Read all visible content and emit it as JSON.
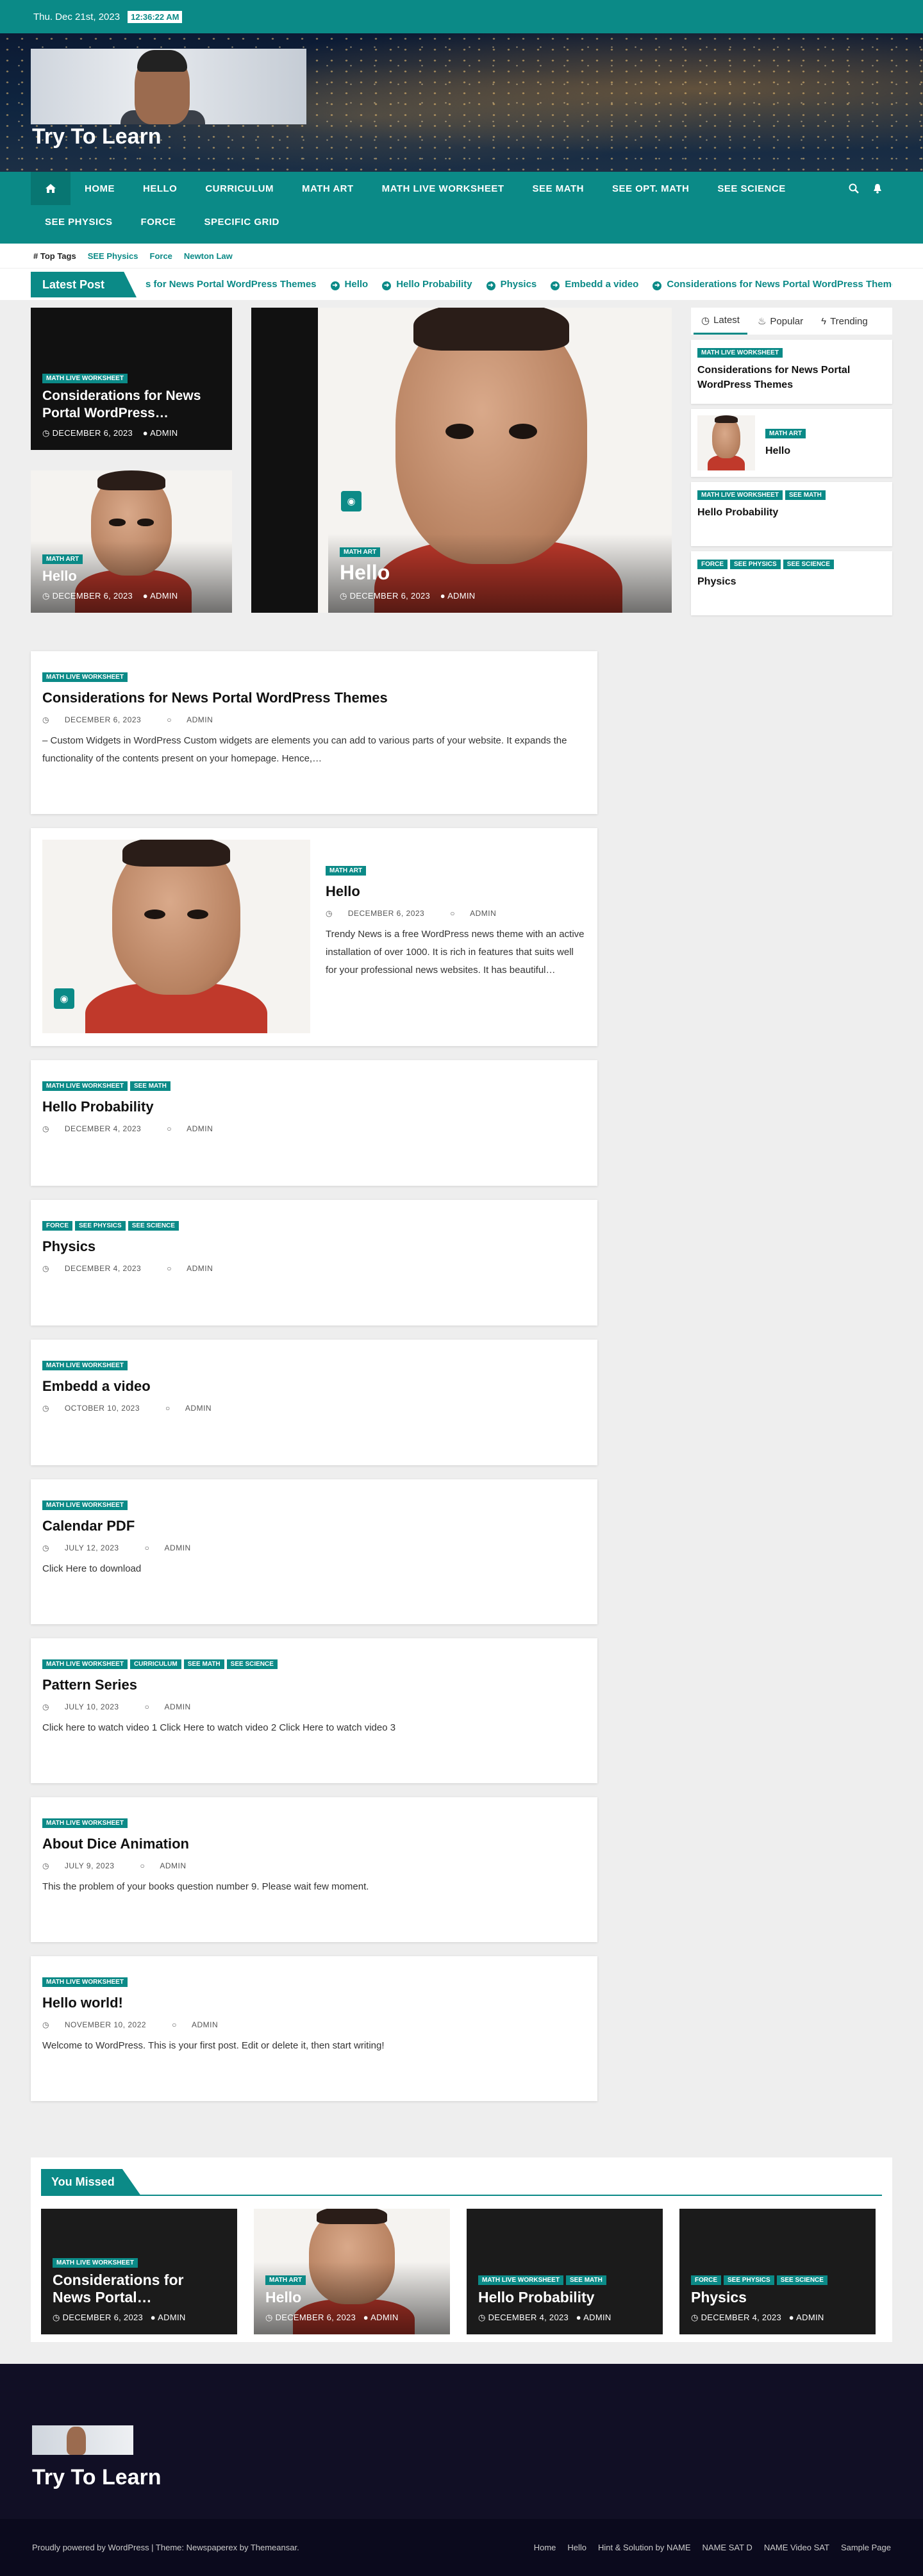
{
  "topbar": {
    "date": "Thu. Dec 21st, 2023",
    "time": "12:36:22 AM"
  },
  "header": {
    "site_title": "Try To Learn"
  },
  "nav": {
    "items": [
      "Home",
      "Hello",
      "Curriculum",
      "Math Art",
      "Math Live Worksheet",
      "See Math",
      "See Opt. Math",
      "See Science",
      "See Physics",
      "Force",
      "Specific Grid"
    ],
    "icons": [
      "home-icon",
      "search-icon",
      "bell-icon"
    ]
  },
  "tags": {
    "label": "Top Tags",
    "items": [
      "SEE Physics",
      "Force",
      "Newton Law"
    ]
  },
  "ticker": {
    "label": "Latest Post",
    "items": [
      "s for News Portal WordPress Themes",
      "Hello",
      "Hello Probability",
      "Physics",
      "Embedd a video",
      "Considerations for News Portal WordPress Themes"
    ]
  },
  "featured": {
    "left1": {
      "cat": "Math Live Worksheet",
      "title": "Considerations for News Portal WordPress…",
      "date": "December 6, 2023",
      "author": "Admin"
    },
    "left2": {
      "cat": "Math Art",
      "title": "Hello",
      "date": "December 6, 2023",
      "author": "Admin"
    },
    "main": {
      "cat": "Math Art",
      "title": "Hello",
      "date": "December 6, 2023",
      "author": "Admin"
    }
  },
  "tabs": {
    "labels": [
      "Latest",
      "Popular",
      "Trending"
    ],
    "items": [
      {
        "cats": [
          "Math Live Worksheet"
        ],
        "title": "Considerations for News Portal WordPress Themes"
      },
      {
        "cats": [
          "Math Art"
        ],
        "title": "Hello"
      },
      {
        "cats": [
          "Math Live Worksheet",
          "See Math"
        ],
        "title": "Hello Probability"
      },
      {
        "cats": [
          "Force",
          "See Physics",
          "See Science"
        ],
        "title": "Physics"
      }
    ]
  },
  "posts": [
    {
      "cats": [
        "Math Live Worksheet"
      ],
      "title": "Considerations for News Portal WordPress Themes",
      "date": "December 6, 2023",
      "author": "Admin",
      "excerpt": "– Custom Widgets in WordPress Custom widgets are elements you can add to various parts of your website. It expands the functionality of the contents present on your homepage.  Hence,…"
    },
    {
      "cats": [
        "Math Art"
      ],
      "title": "Hello",
      "date": "December 6, 2023",
      "author": "Admin",
      "excerpt": "Trendy News is a free WordPress news theme with an active installation of over 1000. It is rich in features that suits well for your professional news websites. It has beautiful…"
    },
    {
      "cats": [
        "Math Live Worksheet",
        "See Math"
      ],
      "title": "Hello Probability",
      "date": "December 4, 2023",
      "author": "Admin",
      "excerpt": ""
    },
    {
      "cats": [
        "Force",
        "See Physics",
        "See Science"
      ],
      "title": "Physics",
      "date": "December 4, 2023",
      "author": "Admin",
      "excerpt": ""
    },
    {
      "cats": [
        "Math Live Worksheet"
      ],
      "title": "Embedd a video",
      "date": "October 10, 2023",
      "author": "Admin",
      "excerpt": ""
    },
    {
      "cats": [
        "Math Live Worksheet"
      ],
      "title": "Calendar PDF",
      "date": "July 12, 2023",
      "author": "Admin",
      "excerpt": "Click Here to download"
    },
    {
      "cats": [
        "Math Live Worksheet",
        "Curriculum",
        "See Math",
        "See Science"
      ],
      "title": "Pattern Series",
      "date": "July 10, 2023",
      "author": "Admin",
      "excerpt": "Click here to watch video 1 Click Here to watch video 2 Click Here to watch video 3"
    },
    {
      "cats": [
        "Math Live Worksheet"
      ],
      "title": "About Dice Animation",
      "date": "July 9, 2023",
      "author": "Admin",
      "excerpt": "This the problem of your books question number 9. Please wait few moment."
    },
    {
      "cats": [
        "Math Live Worksheet"
      ],
      "title": "Hello world!",
      "date": "November 10, 2022",
      "author": "Admin",
      "excerpt": "Welcome to WordPress. This is your first post. Edit or delete it, then start writing!"
    }
  ],
  "missed": {
    "heading": "You Missed",
    "items": [
      {
        "cats": [
          "Math Live Worksheet"
        ],
        "title": "Considerations for News Portal…",
        "date": "December 6, 2023",
        "author": "Admin"
      },
      {
        "cats": [
          "Math Art"
        ],
        "title": "Hello",
        "date": "December 6, 2023",
        "author": "Admin"
      },
      {
        "cats": [
          "Math Live Worksheet",
          "See Math"
        ],
        "title": "Hello Probability",
        "date": "December 4, 2023",
        "author": "Admin"
      },
      {
        "cats": [
          "Force",
          "See Physics",
          "See Science"
        ],
        "title": "Physics",
        "date": "December 4, 2023",
        "author": "Admin"
      }
    ]
  },
  "footer": {
    "site_title": "Try To Learn",
    "copyright": "Proudly powered by WordPress | Theme: Newspaperex by Themeansar.",
    "links": [
      "Home",
      "Hello",
      "Hint & Solution by NAME",
      "NAME SAT D",
      "NAME Video SAT",
      "Sample Page"
    ]
  },
  "colors": {
    "accent": "#0b8a87",
    "footer_bg": "#110f25"
  }
}
